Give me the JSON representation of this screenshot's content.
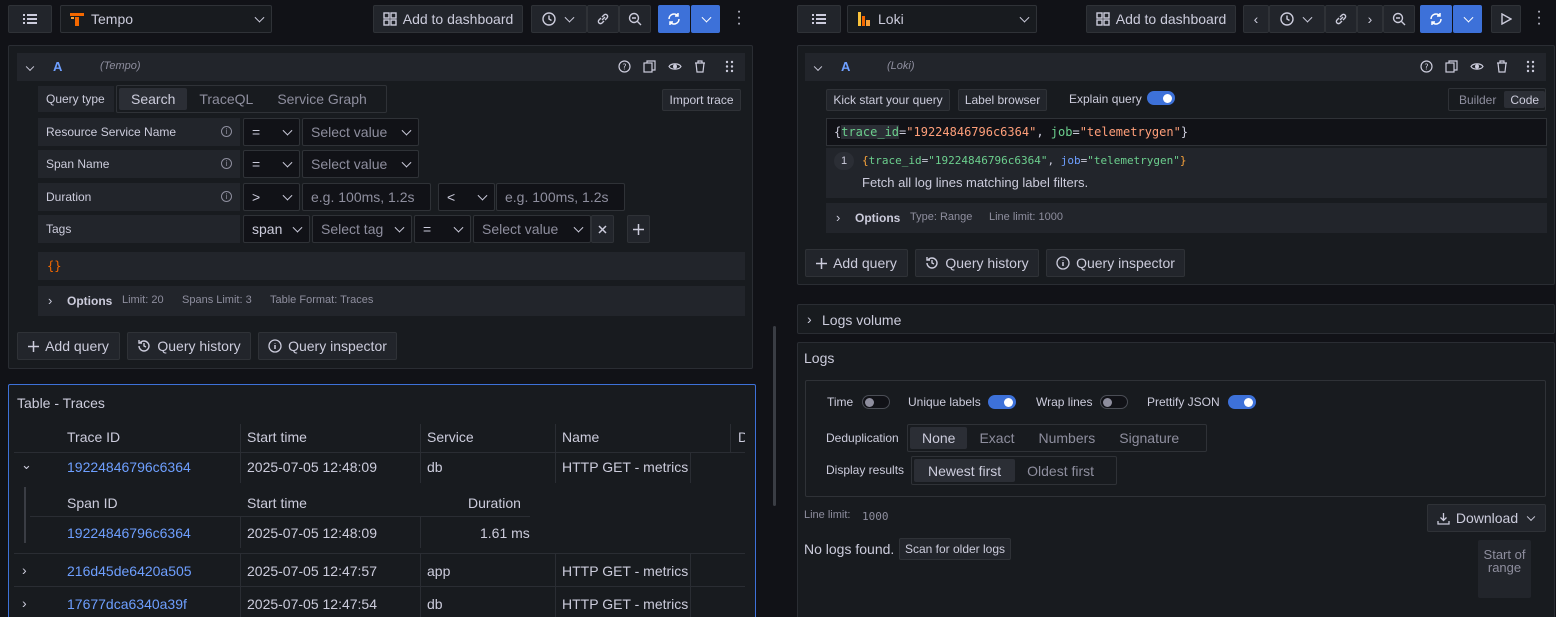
{
  "left": {
    "datasource": "Tempo",
    "add_to_dashboard": "Add to dashboard",
    "query": {
      "ref": "A",
      "ds_label": "(Tempo)",
      "query_type_label": "Query type",
      "tabs": [
        "Search",
        "TraceQL",
        "Service Graph"
      ],
      "import_trace": "Import trace",
      "rows": {
        "service_name": "Resource Service Name",
        "span_name": "Span Name",
        "duration": "Duration",
        "tags": "Tags"
      },
      "ops": {
        "eq": "=",
        "gt": ">",
        "lt": "<"
      },
      "select_value": "Select value",
      "select_tag": "Select tag",
      "span": "span",
      "duration_ph": "e.g. 100ms, 1.2s",
      "traceql_preview": "{}",
      "options_label": "Options",
      "options_summary": [
        "Limit: 20",
        "Spans Limit: 3",
        "Table Format: Traces"
      ]
    },
    "add_query": "Add query",
    "query_history": "Query history",
    "query_inspector": "Query inspector",
    "table": {
      "title": "Table - Traces",
      "columns": [
        "Trace ID",
        "Start time",
        "Service",
        "Name",
        "D"
      ],
      "rows": [
        {
          "trace_id": "19224846796c6364",
          "start": "2025-07-05 12:48:09",
          "service": "db",
          "name": "HTTP GET - metrics"
        },
        {
          "trace_id": "216d45de6420a505",
          "start": "2025-07-05 12:47:57",
          "service": "app",
          "name": "HTTP GET - metrics"
        },
        {
          "trace_id": "17677dca6340a39f",
          "start": "2025-07-05 12:47:54",
          "service": "db",
          "name": "HTTP GET - metrics"
        }
      ],
      "sub_columns": [
        "Span ID",
        "Start time",
        "Duration"
      ],
      "sub_row": {
        "span_id": "19224846796c6364",
        "start": "2025-07-05 12:48:09",
        "duration": "1.61 ms"
      }
    }
  },
  "right": {
    "datasource": "Loki",
    "add_to_dashboard": "Add to dashboard",
    "query": {
      "ref": "A",
      "ds_label": "(Loki)",
      "kick_start": "Kick start your query",
      "label_browser": "Label browser",
      "explain_query": "Explain query",
      "mode_builder": "Builder",
      "mode_code": "Code",
      "code": {
        "open": "{",
        "k1": "trace_id",
        "eq": "=",
        "v1": "\"19224846796c6364\"",
        "sep": ", ",
        "k2": "job",
        "v2": "\"telemetrygen\"",
        "close": "}"
      },
      "explain_step": "1",
      "explain_text": "Fetch all log lines matching label filters.",
      "options_label": "Options",
      "options_summary": [
        "Type: Range",
        "Line limit: 1000"
      ]
    },
    "add_query": "Add query",
    "query_history": "Query history",
    "query_inspector": "Query inspector",
    "logs_volume": "Logs volume",
    "logs": {
      "title": "Logs",
      "time": "Time",
      "unique_labels": "Unique labels",
      "wrap_lines": "Wrap lines",
      "prettify_json": "Prettify JSON",
      "dedup_label": "Deduplication",
      "dedup_options": [
        "None",
        "Exact",
        "Numbers",
        "Signature"
      ],
      "display_label": "Display results",
      "display_options": [
        "Newest first",
        "Oldest first"
      ],
      "line_limit_label": "Line limit:",
      "line_limit_value": "1000",
      "download": "Download",
      "no_logs": "No logs found.",
      "scan_older": "Scan for older logs",
      "start_of_range": "Start of range"
    }
  },
  "colors": {
    "accent": "#3d71d9",
    "link": "#6e9fff",
    "bg": "#111217",
    "panel": "#181b1f"
  }
}
